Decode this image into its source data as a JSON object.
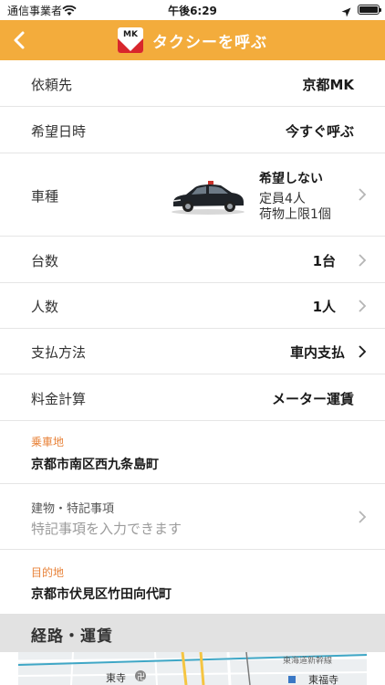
{
  "status_bar": {
    "carrier": "通信事業者",
    "time": "午後6:29"
  },
  "nav": {
    "title": "タクシーを呼ぶ",
    "logo_text": "MK",
    "color": "#f3ac3c"
  },
  "rows": {
    "destination_company": {
      "label": "依頼先",
      "value": "京都MK"
    },
    "datetime": {
      "label": "希望日時",
      "value": "今すぐ呼ぶ"
    },
    "vehicle": {
      "label": "車種",
      "preference": "希望しない",
      "capacity": "定員4人",
      "luggage": "荷物上限1個"
    },
    "car_count": {
      "label": "台数",
      "value": "1台"
    },
    "passengers": {
      "label": "人数",
      "value": "1人"
    },
    "payment": {
      "label": "支払方法",
      "value": "車内支払"
    },
    "fare": {
      "label": "料金計算",
      "value": "メーター運賃"
    }
  },
  "pickup": {
    "label": "乗車地",
    "address": "京都市南区西九条島町",
    "accent": "#e8833a"
  },
  "notes": {
    "label": "建物・特記事項",
    "placeholder": "特記事項を入力できます"
  },
  "dropoff": {
    "label": "目的地",
    "address": "京都市伏見区竹田向代町"
  },
  "route_section": {
    "title": "経路・運賃"
  },
  "map": {
    "labels": [
      "東寺",
      "東福寺"
    ],
    "rail_label": "東海道新幹線"
  }
}
